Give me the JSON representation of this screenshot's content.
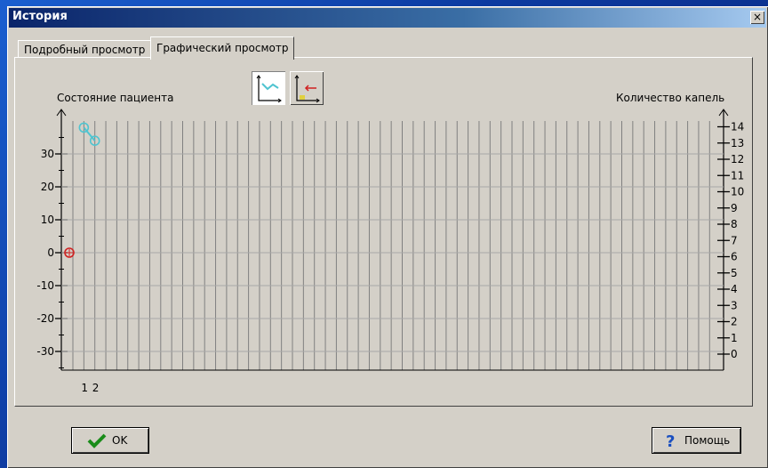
{
  "window": {
    "title": "История",
    "close_label": "×"
  },
  "tabs": [
    {
      "label": "Подробный просмотр",
      "active": false
    },
    {
      "label": "Графический просмотр",
      "active": true
    }
  ],
  "graph": {
    "left_axis_label": "Состояние пациента",
    "right_axis_label": "Количество капель",
    "view_buttons": [
      {
        "icon": "line-chart-icon",
        "active": true
      },
      {
        "icon": "drops-chart-icon",
        "active": false
      }
    ]
  },
  "chart_data": {
    "type": "scatter",
    "left_axis": {
      "label": "Состояние пациента",
      "ticks": [
        30,
        20,
        10,
        0,
        -10,
        -20,
        -30
      ],
      "ylim": [
        -33,
        39
      ]
    },
    "right_axis": {
      "label": "Количество капель",
      "ticks": [
        14,
        13,
        12,
        11,
        10,
        9,
        8,
        7,
        6,
        5,
        4,
        3,
        2,
        1,
        0
      ],
      "ylim": [
        -0.5,
        15
      ]
    },
    "x_ticks": [
      "1",
      "2"
    ],
    "grid": true,
    "series": [
      {
        "x": [
          1,
          2
        ],
        "y": [
          38,
          34
        ],
        "color": "#4fc4d0",
        "axis": "left"
      },
      {
        "x": [
          0
        ],
        "y": [
          0
        ],
        "color": "#d02020",
        "axis": "left"
      }
    ]
  },
  "buttons": {
    "ok_label": "OK",
    "help_label": "Помощь"
  }
}
